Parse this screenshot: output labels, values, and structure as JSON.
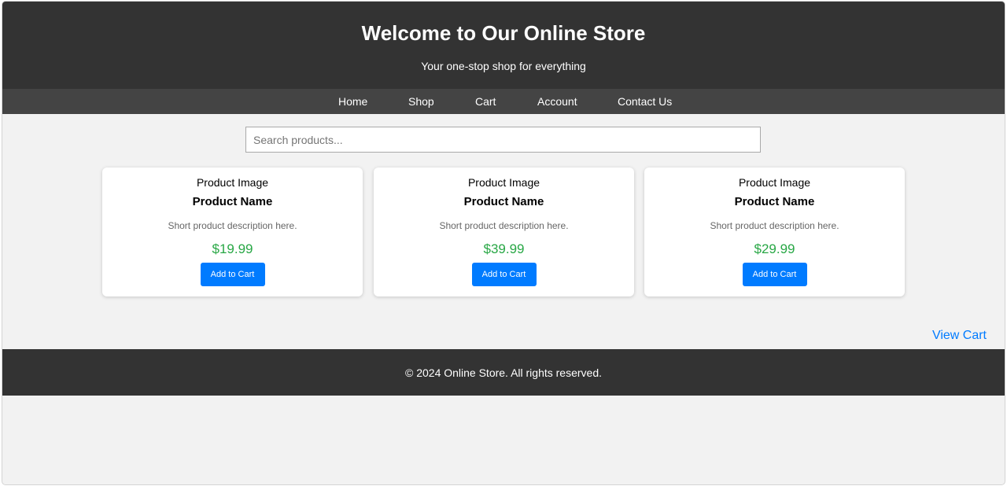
{
  "header": {
    "title": "Welcome to Our Online Store",
    "subtitle": "Your one-stop shop for everything"
  },
  "nav": {
    "items": [
      {
        "label": "Home"
      },
      {
        "label": "Shop"
      },
      {
        "label": "Cart"
      },
      {
        "label": "Account"
      },
      {
        "label": "Contact Us"
      }
    ]
  },
  "search": {
    "placeholder": "Search products...",
    "value": ""
  },
  "products": [
    {
      "image_alt": "Product Image",
      "name": "Product Name",
      "description": "Short product description here.",
      "price": "$19.99",
      "button_label": "Add to Cart"
    },
    {
      "image_alt": "Product Image",
      "name": "Product Name",
      "description": "Short product description here.",
      "price": "$39.99",
      "button_label": "Add to Cart"
    },
    {
      "image_alt": "Product Image",
      "name": "Product Name",
      "description": "Short product description here.",
      "price": "$29.99",
      "button_label": "Add to Cart"
    }
  ],
  "view_cart_label": "View Cart",
  "footer": {
    "copyright": "© 2024 Online Store. All rights reserved."
  },
  "colors": {
    "header_bg": "#333333",
    "nav_bg": "#444444",
    "accent": "#007bff",
    "price": "#28a745",
    "page_bg": "#f2f2f2"
  }
}
